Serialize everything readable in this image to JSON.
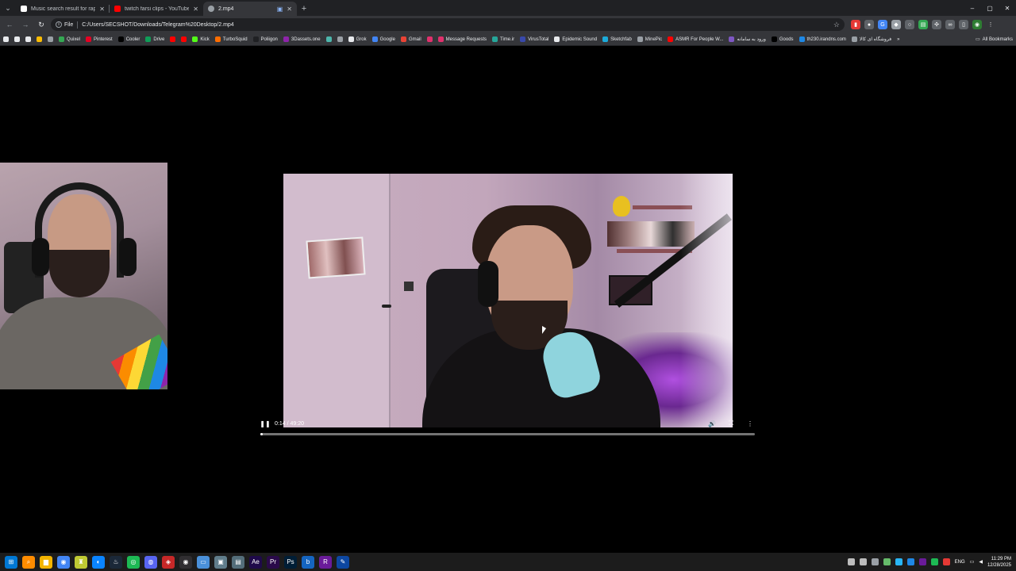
{
  "browser": {
    "tabs": [
      {
        "title": "Music search result for rap | Ep",
        "favicon_color": "#ffffff",
        "active": false
      },
      {
        "title": "twitch farsi clips - YouTube",
        "favicon_color": "#ff0000",
        "active": false
      },
      {
        "title": "2.mp4",
        "favicon_color": "#9aa0a6",
        "active": true
      }
    ],
    "newtab_icon": "plus-icon",
    "window_controls": {
      "minimize": "–",
      "maximize": "▢",
      "close": "✕"
    }
  },
  "toolbar": {
    "chip_label": "File",
    "url": "C:/Users/SECSHOT/Downloads/Telegram%20Desktop/2.mp4",
    "back": "←",
    "forward": "→",
    "reload": "↻",
    "star": "☆",
    "extensions": [
      {
        "name": "pdf-ext-icon",
        "color": "#e53935",
        "glyph": "▮"
      },
      {
        "name": "circle-ext-icon",
        "color": "#5f6368",
        "glyph": "●"
      },
      {
        "name": "translate-ext-icon",
        "color": "#4285f4",
        "glyph": "G"
      },
      {
        "name": "shield-ext-icon",
        "color": "#9aa0a6",
        "glyph": "◆"
      },
      {
        "name": "grey-ext-icon",
        "color": "#5f6368",
        "glyph": "○"
      },
      {
        "name": "sheet-ext-icon",
        "color": "#34a853",
        "glyph": "▤"
      },
      {
        "name": "puzzle-ext-icon",
        "color": "#5f6368",
        "glyph": "✣"
      },
      {
        "name": "glasses-ext-icon",
        "color": "#5f6368",
        "glyph": "∞"
      },
      {
        "name": "sidebar-ext-icon",
        "color": "#5f6368",
        "glyph": "▯"
      },
      {
        "name": "profile-ext-icon",
        "color": "#2e7d32",
        "glyph": "◉"
      },
      {
        "name": "menu-ext-icon",
        "color": "#35363a",
        "glyph": "⋮"
      }
    ]
  },
  "bookmarks": {
    "items": [
      {
        "label": "",
        "color": "#e8eaed"
      },
      {
        "label": "",
        "color": "#e8eaed"
      },
      {
        "label": "",
        "color": "#e8eaed"
      },
      {
        "label": "",
        "color": "#fbbc04"
      },
      {
        "label": "",
        "color": "#9aa0a6"
      },
      {
        "label": "Quixel",
        "color": "#34a853"
      },
      {
        "label": "Pinterest",
        "color": "#e60023"
      },
      {
        "label": "Cooler",
        "color": "#000000"
      },
      {
        "label": "Drive",
        "color": "#0f9d58"
      },
      {
        "label": "",
        "color": "#ff0000"
      },
      {
        "label": "",
        "color": "#ff0000"
      },
      {
        "label": "Kick",
        "color": "#53fc18"
      },
      {
        "label": "TurboSquid",
        "color": "#ff6d00"
      },
      {
        "label": "Poliigon",
        "color": "#202124"
      },
      {
        "label": "3Dassets.one",
        "color": "#8e24aa"
      },
      {
        "label": "",
        "color": "#4db6ac"
      },
      {
        "label": "",
        "color": "#9aa0a6"
      },
      {
        "label": "Grok",
        "color": "#e8eaed"
      },
      {
        "label": "Google",
        "color": "#4285f4"
      },
      {
        "label": "Gmail",
        "color": "#ea4335"
      },
      {
        "label": "",
        "color": "#e1306c"
      },
      {
        "label": "Message Requests",
        "color": "#e1306c"
      },
      {
        "label": "Time.ir",
        "color": "#26a69a"
      },
      {
        "label": "VirusTotal",
        "color": "#3949ab"
      },
      {
        "label": "Epidemic Sound",
        "color": "#e8eaed"
      },
      {
        "label": "Sketchfab",
        "color": "#1caad9"
      },
      {
        "label": "MinePic",
        "color": "#9aa0a6"
      },
      {
        "label": "ASMR For People W...",
        "color": "#ff0000"
      },
      {
        "label": "ورود به سامانه",
        "color": "#7e57c2"
      },
      {
        "label": "Goods",
        "color": "#000000"
      },
      {
        "label": "th230.irandns.com",
        "color": "#1e88e5"
      },
      {
        "label": "فروشگاه ای کالا",
        "color": "#9aa0a6"
      }
    ],
    "overflow": "»",
    "all_bookmarks": "All Bookmarks"
  },
  "player": {
    "play_state_icon": "pause-icon",
    "play_glyph": "❚❚",
    "time": "0:14 / 49:20",
    "progress_fraction": 0.005,
    "volume_glyph": "🔊",
    "fullscreen_glyph": "⛶",
    "more_glyph": "⋮"
  },
  "taskbar": {
    "apps": [
      {
        "name": "start-icon",
        "color": "#0078d4",
        "glyph": "⊞"
      },
      {
        "name": "search-icon",
        "color": "#ff8c00",
        "glyph": "⌕"
      },
      {
        "name": "explorer-icon",
        "color": "#f4b400",
        "glyph": "▆"
      },
      {
        "name": "chrome-icon",
        "color": "#4285f4",
        "glyph": "◉"
      },
      {
        "name": "vpn-icon",
        "color": "#c0ca33",
        "glyph": "♜"
      },
      {
        "name": "edge-icon",
        "color": "#0a84ff",
        "glyph": "◐"
      },
      {
        "name": "steam-icon",
        "color": "#1b2838",
        "glyph": "♨"
      },
      {
        "name": "spotify-icon",
        "color": "#1db954",
        "glyph": "◎"
      },
      {
        "name": "discord-icon",
        "color": "#5865f2",
        "glyph": "◍"
      },
      {
        "name": "davinci-icon",
        "color": "#c62828",
        "glyph": "◈"
      },
      {
        "name": "obs-icon",
        "color": "#302e31",
        "glyph": "◉"
      },
      {
        "name": "monitor-icon",
        "color": "#4a90d9",
        "glyph": "▭"
      },
      {
        "name": "screen-icon",
        "color": "#607d8b",
        "glyph": "▣"
      },
      {
        "name": "notes-icon",
        "color": "#546e7a",
        "glyph": "▤"
      },
      {
        "name": "after-effects-icon",
        "color": "#1f0a4a",
        "glyph": "Ae"
      },
      {
        "name": "premiere-icon",
        "color": "#2a0a4a",
        "glyph": "Pr"
      },
      {
        "name": "photoshop-icon",
        "color": "#001e36",
        "glyph": "Ps"
      },
      {
        "name": "blender-b-icon",
        "color": "#1565c0",
        "glyph": "b"
      },
      {
        "name": "r-app-icon",
        "color": "#6a1b9a",
        "glyph": "R"
      },
      {
        "name": "pen-tool-icon",
        "color": "#0d47a1",
        "glyph": "✎"
      }
    ],
    "tray_icons": [
      "#e53935",
      "#1db954",
      "#6a1b9a",
      "#1e88e5",
      "#29b6f6",
      "#66bb6a",
      "#9aa0a6",
      "#bdbdbd",
      "#bdbdbd"
    ],
    "language": "ENG",
    "time": "11:29 PM",
    "date": "12/28/2025"
  }
}
